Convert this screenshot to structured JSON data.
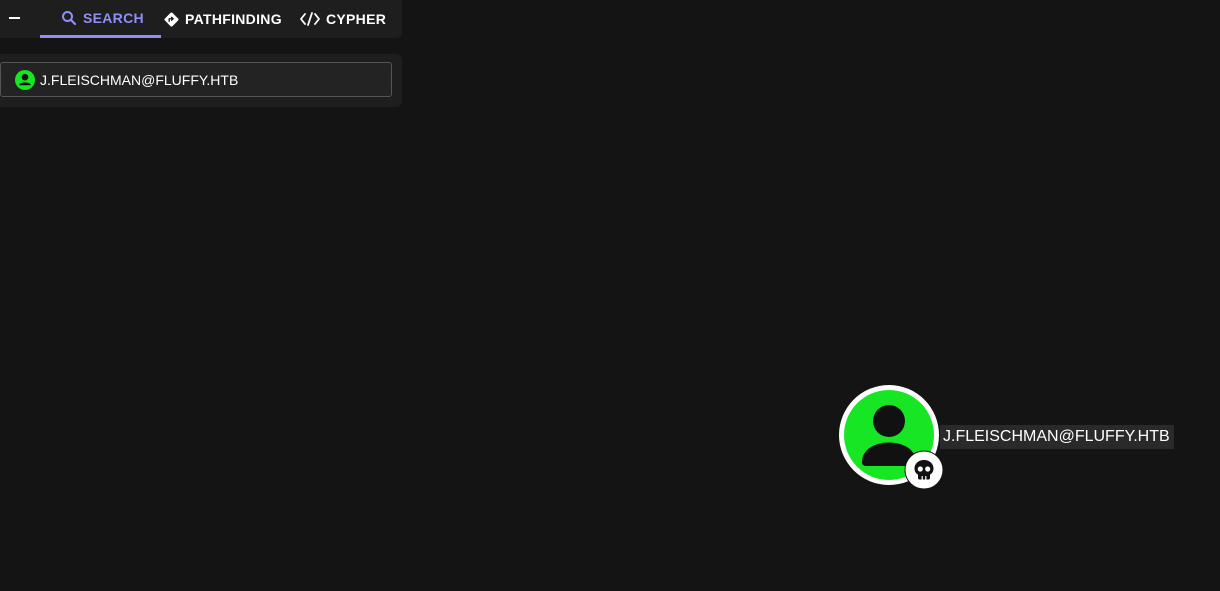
{
  "tabs": [
    {
      "label": "SEARCH",
      "icon": "search-icon",
      "active": true
    },
    {
      "label": "PATHFINDING",
      "icon": "pathfinding-icon",
      "active": false
    },
    {
      "label": "CYPHER",
      "icon": "code-icon",
      "active": false
    }
  ],
  "search": {
    "value": "J.FLEISCHMAN@FLUFFY.HTB",
    "result_icon": "user-icon"
  },
  "graph": {
    "node": {
      "label": "J.FLEISCHMAN@FLUFFY.HTB",
      "type_icon": "user-icon",
      "badge_icon": "skull-icon"
    }
  },
  "colors": {
    "background": "#141414",
    "panel": "#1e1e1e",
    "accent": "#8f8ff5",
    "user_node": "#17e625",
    "text": "#ffffff"
  }
}
